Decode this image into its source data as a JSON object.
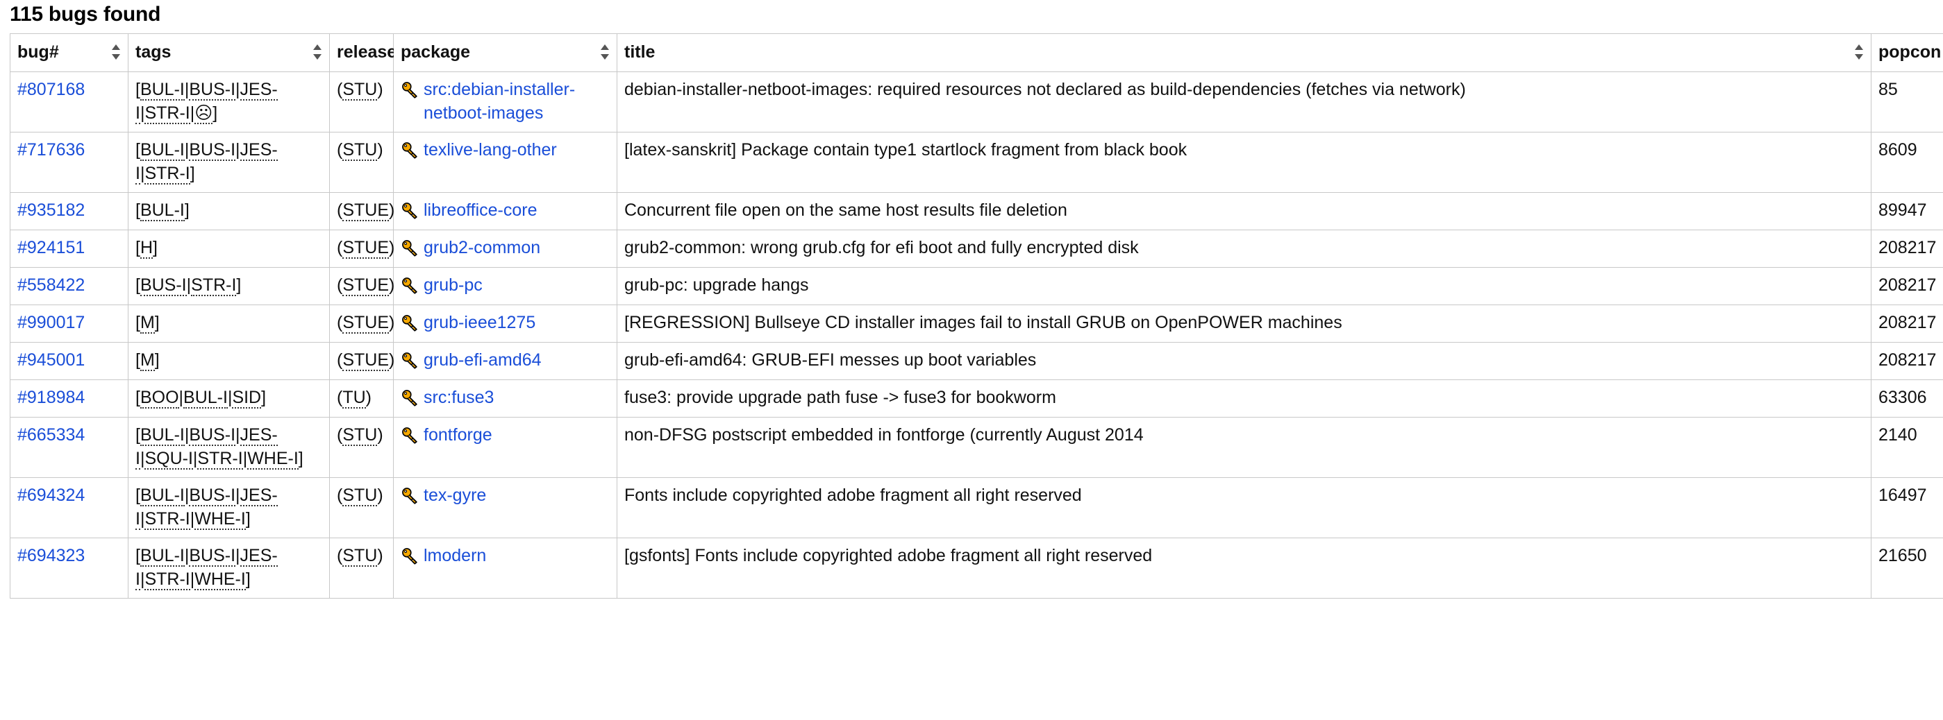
{
  "page": {
    "heading": "115 bugs found"
  },
  "table": {
    "columns": [
      {
        "key": "bug",
        "label": "bug#",
        "sortable": true
      },
      {
        "key": "tags",
        "label": "tags",
        "sortable": true
      },
      {
        "key": "releases",
        "label": "releases",
        "sortable": true
      },
      {
        "key": "package",
        "label": "package",
        "sortable": true
      },
      {
        "key": "title",
        "label": "title",
        "sortable": true
      },
      {
        "key": "popcon",
        "label": "popcon",
        "sortable": true
      }
    ],
    "icons": {
      "package_icon": "key-icon",
      "sort_icon": "sort-updown-icon"
    },
    "rows": [
      {
        "bug": "#807168",
        "tags": "[BUL-I|BUS-I|JES-I|STR-I|☹]",
        "releases": "(STU)",
        "package": "src:debian-installer-netboot-images",
        "title": "debian-installer-netboot-images: required resources not declared as build-dependencies (fetches via network)",
        "popcon": "85"
      },
      {
        "bug": "#717636",
        "tags": "[BUL-I|BUS-I|JES-I|STR-I]",
        "releases": "(STU)",
        "package": "texlive-lang-other",
        "title": "[latex-sanskrit] Package contain type1 startlock fragment from black book",
        "popcon": "8609"
      },
      {
        "bug": "#935182",
        "tags": "[BUL-I]",
        "releases": "(STUE)",
        "package": "libreoffice-core",
        "title": "Concurrent file open on the same host results file deletion",
        "popcon": "89947"
      },
      {
        "bug": "#924151",
        "tags": "[H]",
        "releases": "(STUE)",
        "package": "grub2-common",
        "title": "grub2-common: wrong grub.cfg for efi boot and fully encrypted disk",
        "popcon": "208217"
      },
      {
        "bug": "#558422",
        "tags": "[BUS-I|STR-I]",
        "releases": "(STUE)",
        "package": "grub-pc",
        "title": "grub-pc: upgrade hangs",
        "popcon": "208217"
      },
      {
        "bug": "#990017",
        "tags": "[M]",
        "releases": "(STUE)",
        "package": "grub-ieee1275",
        "title": "[REGRESSION] Bullseye CD installer images fail to install GRUB on OpenPOWER machines",
        "popcon": "208217"
      },
      {
        "bug": "#945001",
        "tags": "[M]",
        "releases": "(STUE)",
        "package": "grub-efi-amd64",
        "title": "grub-efi-amd64: GRUB-EFI messes up boot variables",
        "popcon": "208217"
      },
      {
        "bug": "#918984",
        "tags": "[BOO|BUL-I|SID]",
        "releases": "(TU)",
        "package": "src:fuse3",
        "title": "fuse3: provide upgrade path fuse -> fuse3 for bookworm",
        "popcon": "63306"
      },
      {
        "bug": "#665334",
        "tags": "[BUL-I|BUS-I|JES-I|SQU-I|STR-I|WHE-I]",
        "releases": "(STU)",
        "package": "fontforge",
        "title": "non-DFSG postscript embedded in fontforge (currently August 2014",
        "popcon": "2140"
      },
      {
        "bug": "#694324",
        "tags": "[BUL-I|BUS-I|JES-I|STR-I|WHE-I]",
        "releases": "(STU)",
        "package": "tex-gyre",
        "title": "Fonts include copyrighted adobe fragment all right reserved",
        "popcon": "16497"
      },
      {
        "bug": "#694323",
        "tags": "[BUL-I|BUS-I|JES-I|STR-I|WHE-I]",
        "releases": "(STU)",
        "package": "lmodern",
        "title": "[gsfonts] Fonts include copyrighted adobe fragment all right reserved",
        "popcon": "21650"
      }
    ]
  },
  "colors": {
    "link": "#1a4ed8",
    "border": "#c8c8c8",
    "text": "#111111",
    "key_gold": "#f0a500"
  }
}
